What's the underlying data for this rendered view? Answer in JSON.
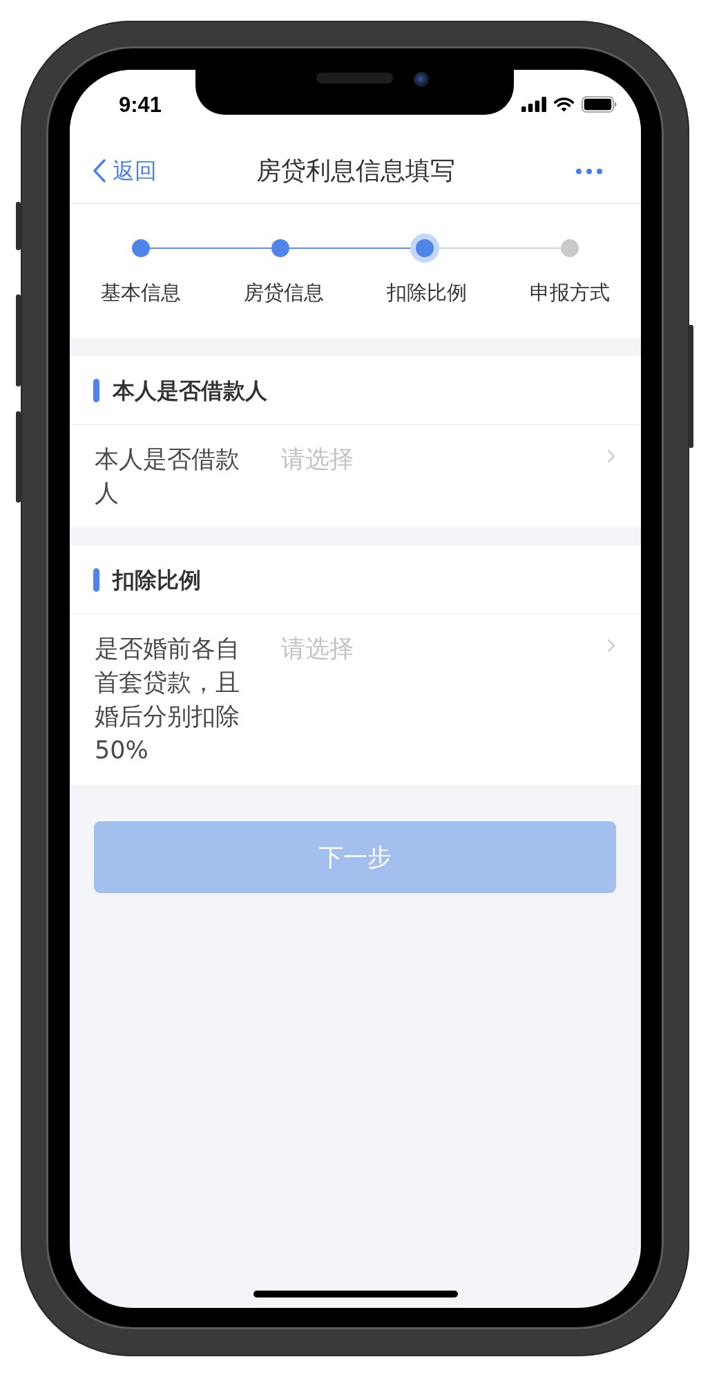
{
  "status_bar": {
    "time": "9:41"
  },
  "nav_bar": {
    "back_label": "返回",
    "title": "房贷利息信息填写"
  },
  "steps": [
    {
      "label": "基本信息",
      "completed": true,
      "selected": false
    },
    {
      "label": "房贷信息",
      "completed": true,
      "selected": false
    },
    {
      "label": "扣除比例",
      "completed": false,
      "selected": true
    },
    {
      "label": "申报方式",
      "completed": false,
      "selected": false
    }
  ],
  "sections": [
    {
      "title": "本人是否借款人",
      "fields": [
        {
          "label": "本人是否借款人",
          "placeholder": "请选择"
        }
      ]
    },
    {
      "title": "扣除比例",
      "fields": [
        {
          "label": "是否婚前各自首套贷款，且婚后分别扣除50%",
          "placeholder": "请选择"
        }
      ]
    }
  ],
  "next_button": {
    "label": "下一步",
    "disabled": true
  }
}
